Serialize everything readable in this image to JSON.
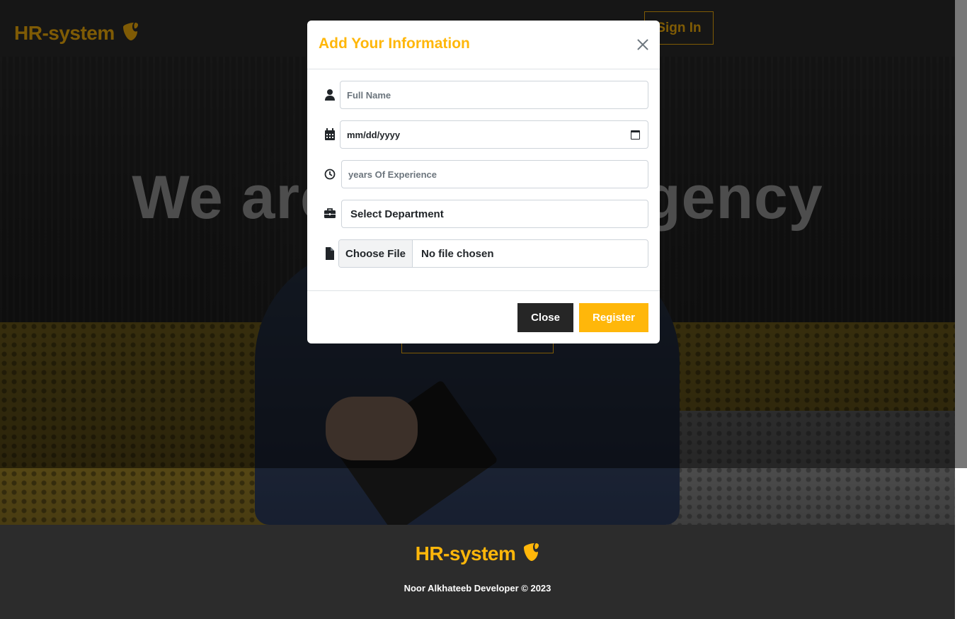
{
  "navbar": {
    "brand": "HR-system",
    "signin_label": "Sign In"
  },
  "hero": {
    "title": "We are the best agency"
  },
  "footer": {
    "brand": "HR-system",
    "copyright": "Noor Alkhateeb Developer © 2023"
  },
  "modal": {
    "title": "Add Your Information",
    "fields": {
      "full_name_placeholder": "Full Name",
      "birthdate_placeholder": "mm/dd/yyyy",
      "experience_placeholder": "years Of Experience",
      "department_selected": "Select Department",
      "file_button": "Choose File",
      "file_status": "No file chosen"
    },
    "icons": [
      "user-icon",
      "calendar-icon",
      "clock-icon",
      "briefcase-icon",
      "file-icon"
    ],
    "buttons": {
      "close": "Close",
      "register": "Register"
    }
  },
  "colors": {
    "accent": "#ffb70a",
    "dark": "#2c2c2c",
    "close_button": "#262626"
  }
}
